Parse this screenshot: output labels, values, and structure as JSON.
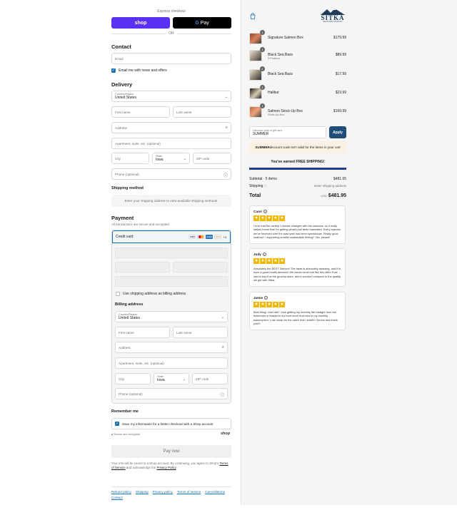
{
  "express": {
    "label": "Express checkout",
    "shop_label": "shop",
    "gpay_label": "Pay",
    "or_label": "OR"
  },
  "contact": {
    "heading": "Contact",
    "email_placeholder": "Email",
    "news_label": "Email me with news and offers"
  },
  "delivery": {
    "heading": "Delivery",
    "country_label": "Country/Region",
    "country_value": "United States",
    "first_name": "First name",
    "last_name": "Last name",
    "address": "Address",
    "apartment": "Apartment, suite, etc. (optional)",
    "city": "City",
    "state_label": "State",
    "state_value": "Iowa",
    "zip": "ZIP code",
    "phone": "Phone (optional)"
  },
  "shipping": {
    "heading": "Shipping method",
    "message": "Enter your shipping address to view available shipping methods."
  },
  "payment": {
    "heading": "Payment",
    "subtitle": "All transactions are secure and encrypted.",
    "method": "Credit card",
    "cards": [
      "VISA",
      "MC",
      "AMEX",
      "DISC"
    ],
    "more_cards": "+4",
    "billing_same_label": "Use shipping address as billing address"
  },
  "billing": {
    "heading": "Billing address",
    "country_label": "Country/Region",
    "country_value": "United States",
    "first_name": "First name",
    "last_name": "Last name",
    "address": "Address",
    "apartment": "Apartment, suite, etc. (optional)",
    "city": "City",
    "state_label": "State",
    "state_value": "Iowa",
    "zip": "ZIP code",
    "phone": "Phone (optional)"
  },
  "remember": {
    "heading": "Remember me",
    "save_label": "Save my information for a faster checkout with a Shop account",
    "secure_label": "Secure and encrypted",
    "shop_brand": "shop"
  },
  "pay_now": "Pay now",
  "fine_print": {
    "part1": "Your info will be saved to a Shop account. By continuing, you agree to Shop's ",
    "tos": "Terms of Service",
    "part2": " and acknowledge the ",
    "privacy": "Privacy Policy",
    "part3": "."
  },
  "footer": {
    "links": [
      "Refund policy",
      "Shipping",
      "Privacy policy",
      "Terms of service",
      "Cancellations",
      "Contact"
    ]
  },
  "brand": {
    "name": "SITKA",
    "tagline": "SEAFOOD MARKET",
    "color": "#1f3b57"
  },
  "cart": {
    "items": [
      {
        "name": "Signature Salmon Box",
        "sub": "",
        "price": "$179.99",
        "qty": "1"
      },
      {
        "name": "Black Sea Bass",
        "sub": "5 Portions",
        "price": "$89.99",
        "qty": "1"
      },
      {
        "name": "Black Sea Bass",
        "sub": "",
        "price": "$17.99",
        "qty": "1"
      },
      {
        "name": "Halibut",
        "sub": "",
        "price": "$23.99",
        "qty": "1"
      },
      {
        "name": "Salmon Stock-Up Box",
        "sub": "Stock-Up Box",
        "price": "$169.99",
        "qty": "1"
      }
    ],
    "discount_label": "Discount code or gift card",
    "discount_value": "SUMMER",
    "apply_label": "Apply",
    "warning_code": "SUMMER",
    "warning_text": " discount code isn't valid for the items in your cart",
    "free_shipping": "You've earned FREE SHIPPING!",
    "subtotal_label": "Subtotal · 5 items",
    "subtotal_value": "$481.95",
    "shipping_label": "Shipping",
    "shipping_value": "Enter shipping address",
    "total_label": "Total",
    "currency": "USD",
    "total_value": "$481.95"
  },
  "reviews": [
    {
      "name": "Carol",
      "stars": 5,
      "text": "I love that the variety I receive changes with the seasons, so it really strikes home that I'm getting what's just been harvested. Every species we've received over the past year has been spectacular. Really good seafood + supporting smaller sustainable fishing? Yes, please!"
    },
    {
      "name": "Judy",
      "stars": 5,
      "text": "Absolutely the BEST Salmon! The taste is absolutely amazing, and it is such a good health decision! We would never eat fish this often if we had to buy it at the grocery store, and it wouldn't compare to the quality we get with Sitka."
    },
    {
      "name": "Jamie",
      "stars": 5,
      "text": "Best thing I ever did! I love getting my monthly fish straight from the fishermen in Alaska to my front door! And now in my monthly subscription. I can swap for the catch that I want!!! Genius and thank you!!!"
    }
  ]
}
